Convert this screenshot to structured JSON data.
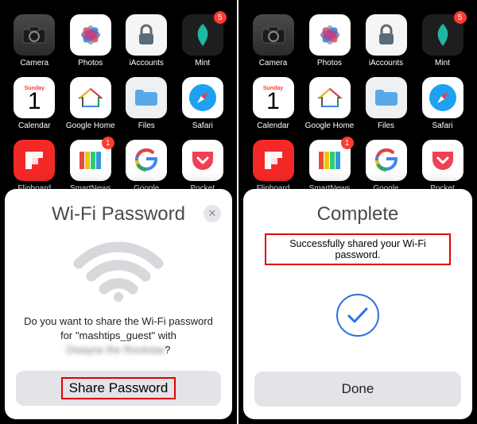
{
  "apps": {
    "row1": [
      {
        "label": "Camera"
      },
      {
        "label": "Photos"
      },
      {
        "label": "iAccounts"
      },
      {
        "label": "Mint",
        "badge": "5"
      }
    ],
    "row2": [
      {
        "label": "Calendar",
        "cal_day": "Sunday",
        "cal_num": "1"
      },
      {
        "label": "Google Home"
      },
      {
        "label": "Files"
      },
      {
        "label": "Safari"
      }
    ],
    "row3": [
      {
        "label": "Flipboard"
      },
      {
        "label": "SmartNews",
        "badge": "1"
      },
      {
        "label": "Google"
      },
      {
        "label": "Pocket"
      }
    ]
  },
  "left_sheet": {
    "title": "Wi-Fi Password",
    "prompt_line1": "Do you want to share the Wi-Fi password",
    "prompt_line2_a": "for \"mashtips_guest\" with",
    "prompt_contact": "Dwayne the Rockstar",
    "prompt_q": "?",
    "button": "Share Password"
  },
  "right_sheet": {
    "title": "Complete",
    "message": "Successfully shared your Wi-Fi password.",
    "button": "Done"
  }
}
